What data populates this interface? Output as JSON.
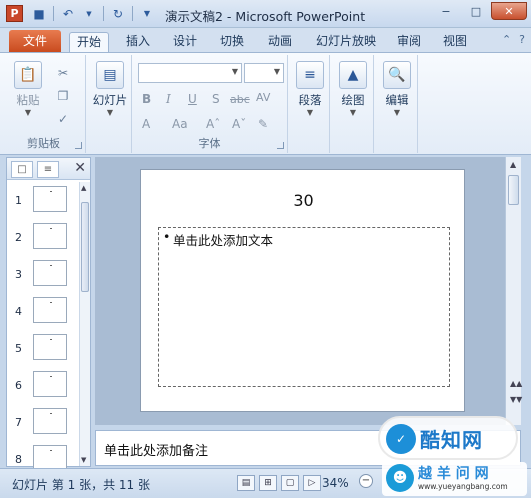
{
  "titlebar": {
    "app_icon_letter": "P",
    "title": "演示文稿2 - Microsoft PowerPoint",
    "qat": [
      "save-icon",
      "undo-icon",
      "redo-icon",
      "customize-icon"
    ],
    "controls": {
      "minimize": "−",
      "maximize": "□",
      "close": "✕"
    }
  },
  "tabs": {
    "file": "文件",
    "items": [
      "开始",
      "插入",
      "设计",
      "切换",
      "动画",
      "幻灯片放映",
      "审阅",
      "视图"
    ],
    "active": "开始"
  },
  "ribbon": {
    "clipboard": {
      "paste": "粘贴",
      "label": "剪贴板"
    },
    "slides": {
      "new_slide": "幻灯片"
    },
    "font": {
      "label": "字体",
      "font_name": "",
      "font_size": ""
    },
    "paragraph": {
      "label": "段落"
    },
    "drawing": {
      "label": "绘图"
    },
    "editing": {
      "label": "编辑"
    }
  },
  "slides_panel": {
    "numbers": [
      "1",
      "2",
      "3",
      "4",
      "5",
      "6",
      "7",
      "8"
    ]
  },
  "slide": {
    "title": "30",
    "content_placeholder": "单击此处添加文本"
  },
  "notes": {
    "placeholder": "单击此处添加备注"
  },
  "statusbar": {
    "slide_info": "幻灯片 第 1 张，共 11 张",
    "zoom": "34%"
  },
  "watermarks": {
    "top_logo": "酷知网",
    "bottom_title": "越 羊 问 网",
    "bottom_url": "www.yueyangbang.com"
  }
}
